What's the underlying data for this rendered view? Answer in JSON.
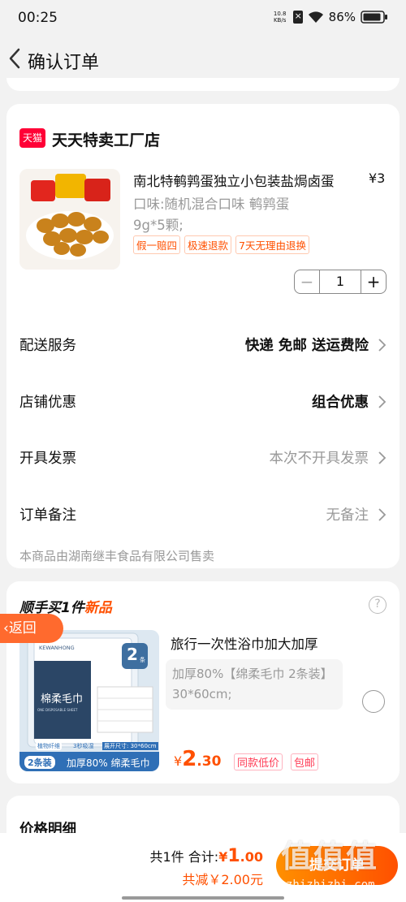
{
  "status_bar": {
    "time": "00:25",
    "net_speed_value": "10.8",
    "net_speed_unit": "KB/s",
    "battery": "86%"
  },
  "nav": {
    "title": "确认订单"
  },
  "shop": {
    "logo_text": "天猫",
    "name": "天天特卖工厂店"
  },
  "product": {
    "title": "南北特鹌鹑蛋独立小包装盐焗卤蛋",
    "price": "¥3",
    "spec_line1": "口味:随机混合口味 鹌鹑蛋",
    "spec_line2": "9g*5颗;",
    "tags": [
      "假一赔四",
      "极速退款",
      "7天无理由退换"
    ],
    "quantity": "1",
    "image_label": "一袋鹌鹑蛋"
  },
  "rows": [
    {
      "label": "配送服务",
      "value": "快递 免邮 送运费险"
    },
    {
      "label": "店铺优惠",
      "value": "组合优惠"
    },
    {
      "label": "开具发票",
      "value": "本次不开具发票"
    },
    {
      "label": "订单备注",
      "value": "无备注"
    }
  ],
  "seller_note": "本商品由湖南继丰食品有限公司售卖",
  "addon": {
    "title_prefix": "顺手买1件",
    "title_new": "新品",
    "name": "旅行一次性浴巾加大加厚",
    "desc": "加厚80%【绵柔毛巾 2条装】30*60cm;",
    "price_symbol": "¥",
    "price_int": "2",
    "price_dec": ".30",
    "tags": [
      "同款低价",
      "包邮"
    ],
    "image": {
      "brand": "KEWANHONG",
      "count": "2",
      "count_unit": "条",
      "product_text": "棉柔毛巾",
      "sub_text": "ONE DISPOSABLE SHEET",
      "badge1": "植物纤维",
      "badge2": "3秒吸湿",
      "size": "展开尺寸: 30*60cm",
      "pack": "2条装",
      "slogan": "加厚80% 绵柔毛巾"
    }
  },
  "back_button": "返回",
  "price_detail_title": "价格明细",
  "bottom": {
    "count_text": "共1件",
    "total_label": "合计:",
    "total_symbol": "¥",
    "total_int": "1",
    "total_dec": ".00",
    "discount_text": "共减￥2.00元",
    "submit_label": "提交订单"
  },
  "watermark": {
    "glyphs": "值值值",
    "url": "zhizhizhi.com"
  },
  "colors": {
    "accent": "#ff5000",
    "tmall_red": "#ff0036",
    "back_pill": "#ff6a2e"
  }
}
